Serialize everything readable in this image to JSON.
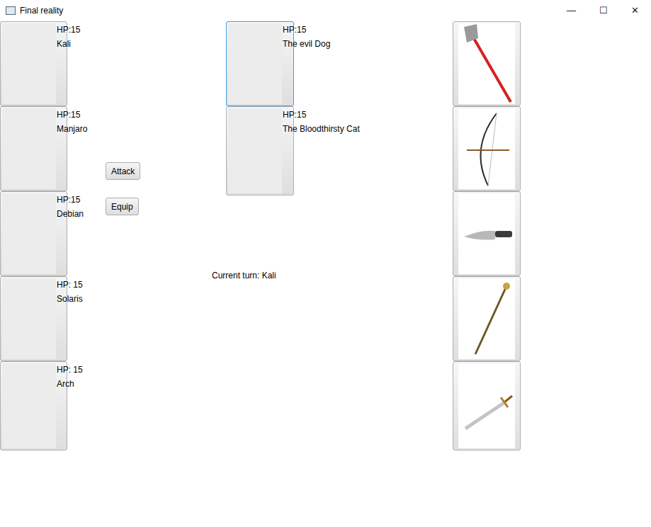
{
  "window": {
    "title": "Final reality",
    "controls": [
      "—",
      "☐",
      "✕"
    ]
  },
  "characters": [
    {
      "hp": "HP:15",
      "name": "Kali"
    },
    {
      "hp": "HP:15",
      "name": "Manjaro"
    },
    {
      "hp": "HP:15",
      "name": "Debian"
    },
    {
      "hp": "HP: 15",
      "name": "Solaris"
    },
    {
      "hp": "HP: 15",
      "name": "Arch"
    }
  ],
  "actions": [
    "Attack",
    "Equip"
  ],
  "enemies": [
    {
      "hp": "HP:15",
      "name": "The evil Dog",
      "selected": true
    },
    {
      "hp": "HP:15",
      "name": "The Bloodthirsty Cat",
      "selected": false
    }
  ],
  "turn": "Current turn: Kali",
  "weapons": [
    {
      "kind": "axe"
    },
    {
      "kind": "bow"
    },
    {
      "kind": "knife"
    },
    {
      "kind": "staff"
    },
    {
      "kind": "sword"
    }
  ]
}
